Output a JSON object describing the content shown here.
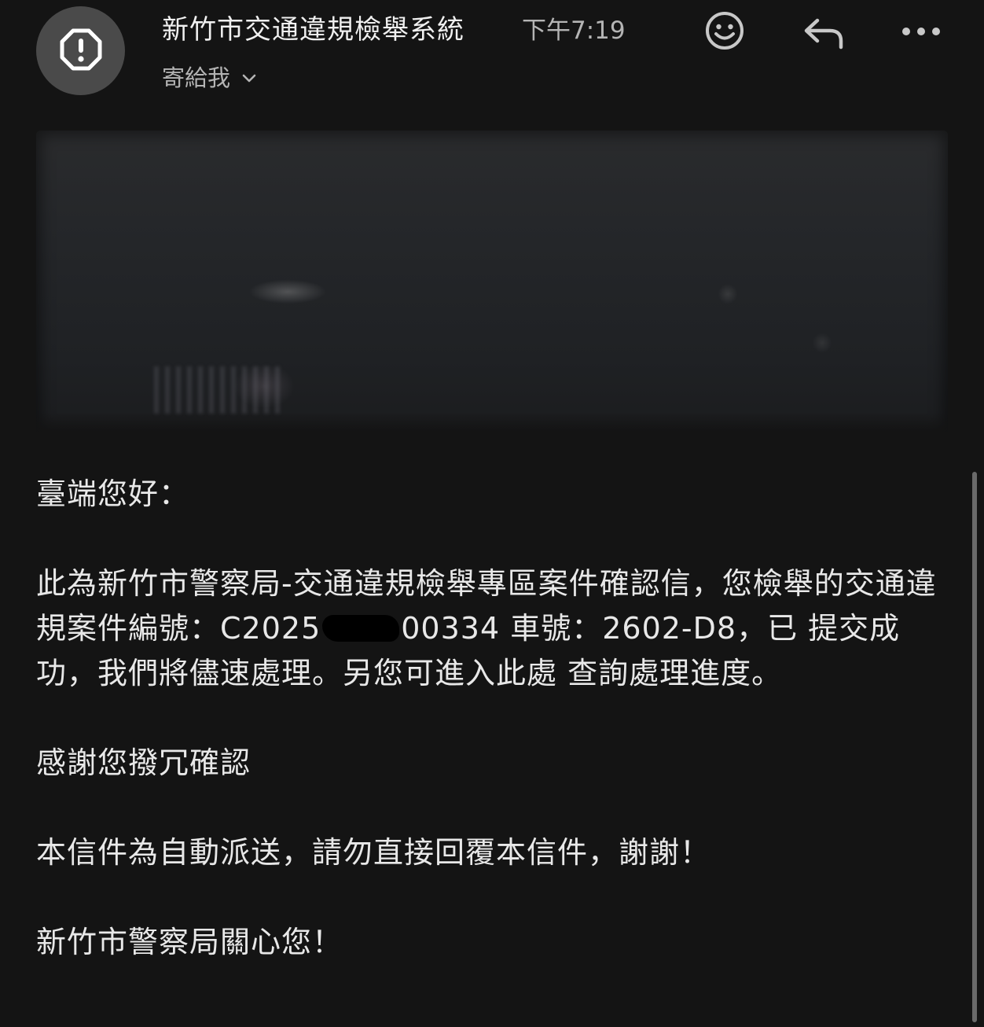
{
  "header": {
    "sender_name": "新竹市交通違規檢舉系統",
    "time": "下午7:19",
    "recipient_label": "寄給我",
    "avatar_icon": "alert-octagon-icon",
    "actions": {
      "emoji_icon": "smiley-icon",
      "reply_icon": "reply-icon",
      "more_icon": "more-horizontal-icon"
    }
  },
  "email": {
    "greeting": "臺端您好：",
    "para1_before_redaction": "此為新竹市警察局-交通違規檢舉專區案件確認信，您檢舉的交通違規案件編號：C2025",
    "para1_after_redaction": "00334 車號：2602-D8，已 提交成功，我們將儘速處理。另您可進入此處 查詢處理進度。",
    "thanks": "感謝您撥冗確認",
    "auto_notice": "本信件為自動派送，請勿直接回覆本信件，謝謝！",
    "signoff": "新竹市警察局關心您！"
  },
  "colors": {
    "background": "#141414",
    "avatar": "#4a4a4a",
    "text_primary": "#e8e8e8",
    "text_secondary": "#b4b4b4"
  }
}
